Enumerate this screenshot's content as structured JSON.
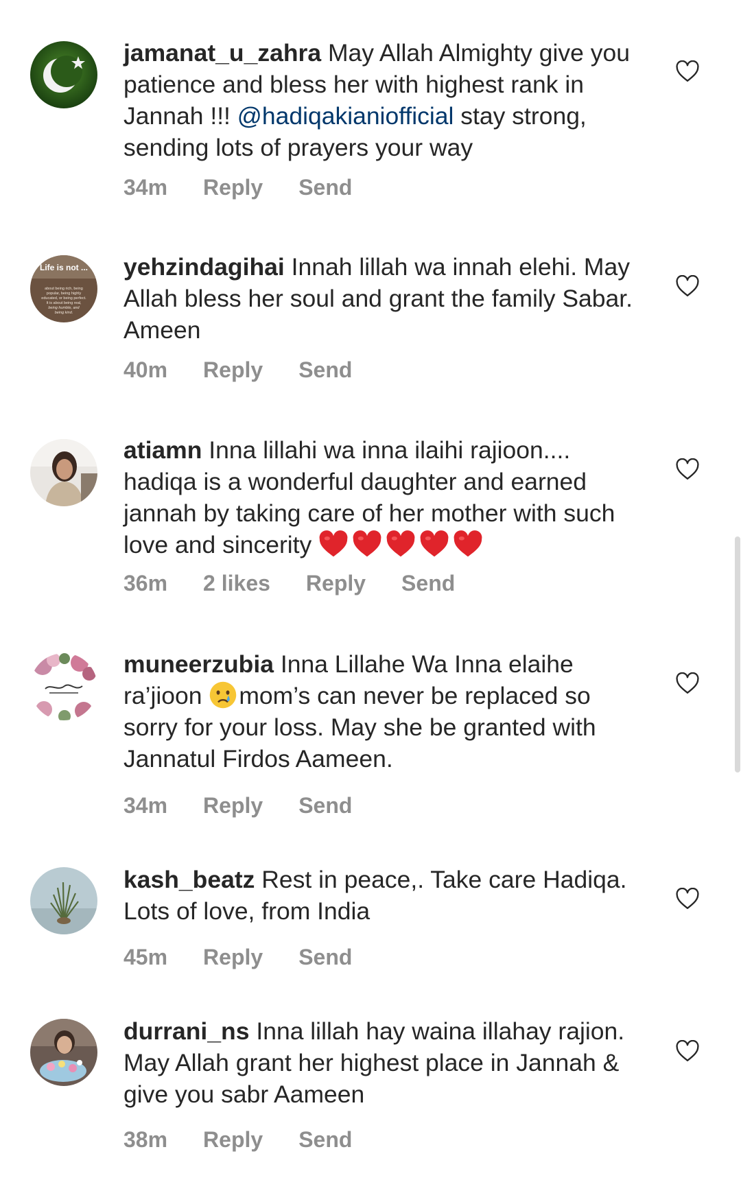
{
  "colors": {
    "text": "#262626",
    "meta": "#8e8e8e",
    "mention": "#00376b",
    "heart_emoji": "#e0242b"
  },
  "icons": {
    "like": "heart-outline-icon",
    "emoji_heart": "red-heart-emoji",
    "emoji_cry": "crying-face-emoji"
  },
  "comments": [
    {
      "username": "jamanat_u_zahra",
      "text_before": "May Allah Almighty give you patience and bless her with highest rank in Jannah !!! ",
      "mention": "@hadiqakianiofficial",
      "text_after": " stay strong, sending lots of prayers your way",
      "time": "34m",
      "reply": "Reply",
      "send": "Send"
    },
    {
      "username": "yehzindagihai",
      "text": "Innah lillah wa innah elehi. May Allah bless her soul and grant the family Sabar. Ameen",
      "time": "40m",
      "reply": "Reply",
      "send": "Send",
      "avatar_text": {
        "title": "Life is not ...",
        "line1": "about being rich, being",
        "line2": "popular, being highly",
        "line3": "educated, or being perfect.",
        "line4": "It is about being real,",
        "line5": "being humble, and",
        "line6": "being kind."
      }
    },
    {
      "username": "atiamn",
      "text": "Inna lillahi wa inna ilaihi rajioon.... hadiqa is a wonderful daughter and earned jannah by taking care of her mother with such love and sincerity ",
      "heart_count": 5,
      "time": "36m",
      "likes": "2 likes",
      "reply": "Reply",
      "send": "Send"
    },
    {
      "username": "muneerzubia",
      "text_before": "Inna Lillahe Wa Inna elaihe ra’jioon ",
      "text_after": "mom’s can never be replaced so sorry for your loss. May she be granted with Jannatul Firdos Aameen.",
      "time": "34m",
      "reply": "Reply",
      "send": "Send"
    },
    {
      "username": "kash_beatz",
      "text": "Rest in peace,. Take care Hadiqa. Lots of love, from India",
      "time": "45m",
      "reply": "Reply",
      "send": "Send"
    },
    {
      "username": "durrani_ns",
      "text": "Inna lillah hay waina illahay rajion. May Allah grant her highest place in Jannah & give you sabr Aameen",
      "time": "38m",
      "reply": "Reply",
      "send": "Send"
    }
  ]
}
